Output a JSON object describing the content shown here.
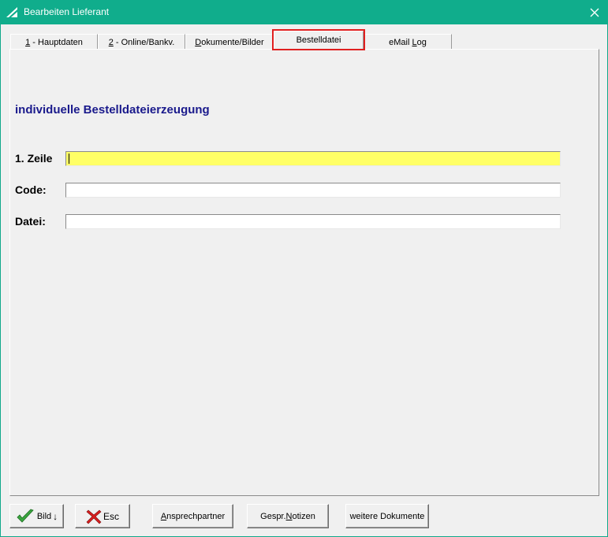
{
  "window": {
    "title": "Bearbeiten Lieferant",
    "close_glyph": "✕",
    "titlebar_color": "#10ad8c"
  },
  "tabs": [
    {
      "hotkey": "1",
      "rest": " - Hauptdaten"
    },
    {
      "hotkey": "2",
      "rest": " - Online/Bankv."
    },
    {
      "hotkey": "D",
      "rest": "okumente/Bilder"
    },
    {
      "label": "Bestelldatei",
      "active": true
    },
    {
      "pre": "eMail ",
      "hotkey": "L",
      "rest": "og"
    }
  ],
  "panel": {
    "heading": "individuelle Bestelldateierzeugung",
    "heading_color": "#1a1a8c",
    "fields": [
      {
        "label": "1. Zeile",
        "value": "",
        "focused": true
      },
      {
        "label": "Code:",
        "value": ""
      },
      {
        "label": "Datei:",
        "value": ""
      }
    ],
    "focus_color": "#ffff66"
  },
  "buttons": {
    "bild": {
      "label": "Bild",
      "icon": "check-icon",
      "arrow": "↓"
    },
    "esc": {
      "label": "Esc",
      "icon": "red-x-icon"
    },
    "ansprechpartner": {
      "hotkey": "A",
      "rest": "nsprechpartner"
    },
    "notizen": {
      "pre": "Gespr.",
      "hotkey": "N",
      "rest": "otizen"
    },
    "dokumente": {
      "label": "weitere Dokumente"
    }
  }
}
